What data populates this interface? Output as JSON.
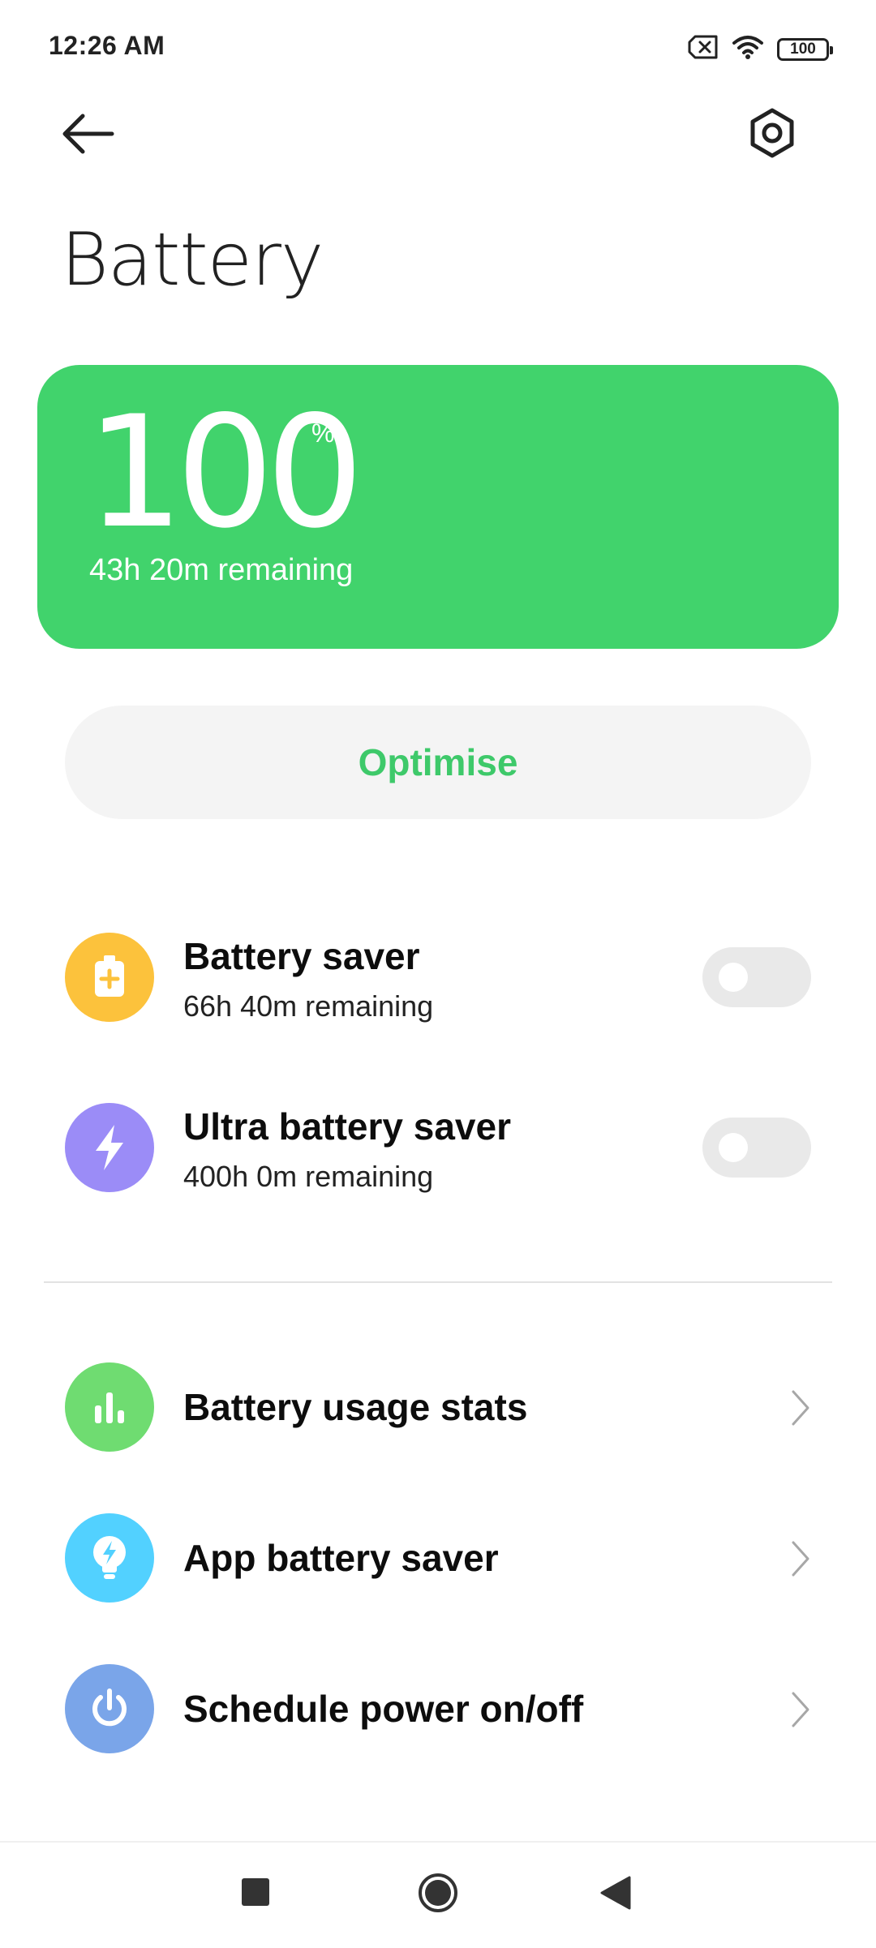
{
  "status_bar": {
    "time": "12:26 AM",
    "battery_level": "100"
  },
  "header": {
    "title": "Battery"
  },
  "battery_card": {
    "percent": "100",
    "percent_sign": "%",
    "remaining": "43h 20m remaining",
    "color": "#41d36c"
  },
  "optimise": {
    "label": "Optimise",
    "color": "#3ec96a"
  },
  "savers": [
    {
      "title": "Battery saver",
      "subtitle": "66h 40m remaining",
      "icon": "battery-plus-icon",
      "icon_color": "#fcc23c",
      "enabled": false
    },
    {
      "title": "Ultra battery saver",
      "subtitle": "400h 0m remaining",
      "icon": "lightning-icon",
      "icon_color": "#9b8cf7",
      "enabled": false
    }
  ],
  "menu": [
    {
      "title": "Battery usage stats",
      "icon": "bar-chart-icon",
      "icon_color": "#6fdc71"
    },
    {
      "title": "App battery saver",
      "icon": "bulb-bolt-icon",
      "icon_color": "#52d1ff"
    },
    {
      "title": "Schedule power on/off",
      "icon": "power-icon",
      "icon_color": "#7aa5e9"
    }
  ],
  "nav": {
    "recents_icon": "square-icon",
    "home_icon": "circle-icon",
    "back_icon": "triangle-back-icon"
  }
}
